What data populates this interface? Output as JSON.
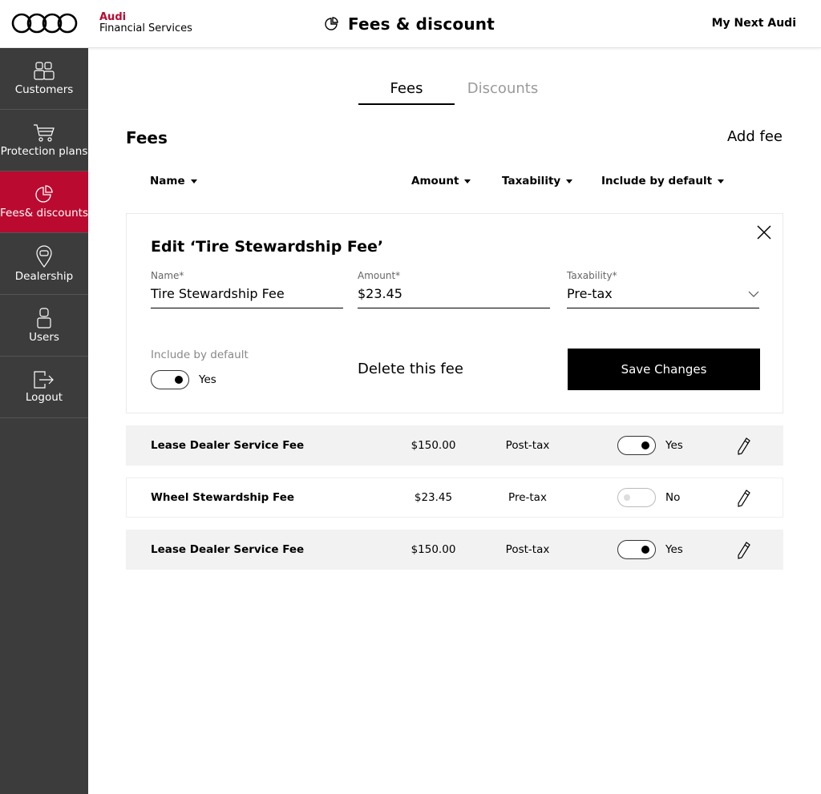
{
  "header": {
    "brand_line1": "Audi",
    "brand_line2": "Financial Services",
    "page_title": "Fees & discount",
    "right_link": "My Next Audi",
    "brand_color": "#bb0a30"
  },
  "sidebar": {
    "items": [
      {
        "label": "Customers",
        "icon": "customers-icon",
        "active": false
      },
      {
        "label": "Protection plans",
        "icon": "cart-icon",
        "active": false
      },
      {
        "label": "Fees& discounts",
        "icon": "pie-chart-icon",
        "active": true
      },
      {
        "label": "Dealership",
        "icon": "location-pin-icon",
        "active": false
      },
      {
        "label": "Users",
        "icon": "user-icon",
        "active": false
      },
      {
        "label": "Logout",
        "icon": "logout-icon",
        "active": false
      }
    ]
  },
  "tabs": [
    {
      "label": "Fees",
      "active": true
    },
    {
      "label": "Discounts",
      "active": false
    }
  ],
  "section": {
    "title": "Fees",
    "add_label": "Add fee"
  },
  "columns": {
    "name": "Name",
    "amount": "Amount",
    "taxability": "Taxability",
    "include_default": "Include by default"
  },
  "edit": {
    "title": "Edit ‘Tire Stewardship Fee’",
    "name_label": "Name*",
    "name_value": "Tire Stewardship Fee",
    "amount_label": "Amount*",
    "amount_value": "$23.45",
    "tax_label": "Taxability*",
    "tax_value": "Pre-tax",
    "include_label": "Include by default",
    "include_value": "Yes",
    "delete_label": "Delete this fee",
    "save_label": "Save Changes"
  },
  "rows": [
    {
      "name": "Lease Dealer Service Fee",
      "amount": "$150.00",
      "tax": "Post-tax",
      "include": "Yes",
      "on": true
    },
    {
      "name": "Wheel Stewardship Fee",
      "amount": "$23.45",
      "tax": "Pre-tax",
      "include": "No",
      "on": false
    },
    {
      "name": "Lease Dealer Service Fee",
      "amount": "$150.00",
      "tax": "Post-tax",
      "include": "Yes",
      "on": true
    }
  ]
}
